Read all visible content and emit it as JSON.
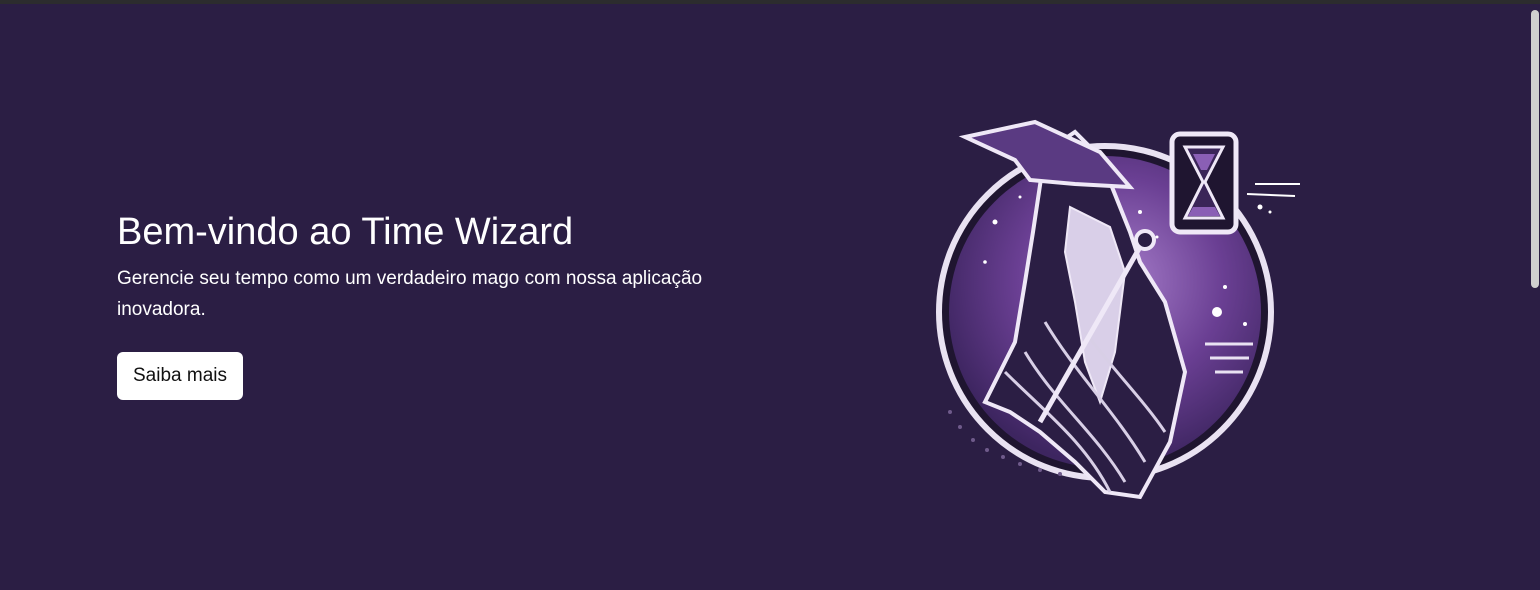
{
  "hero": {
    "title": "Bem-vindo ao Time Wizard",
    "subtitle": "Gerencie seu tempo como um verdadeiro mago com nossa aplicação inovadora.",
    "cta_label": "Saiba mais"
  },
  "logo": {
    "icon": "wizard-hourglass-logo"
  },
  "colors": {
    "background": "#2b1e44",
    "accent_purple": "#6b3f94",
    "text": "#ffffff",
    "button_bg": "#ffffff"
  }
}
